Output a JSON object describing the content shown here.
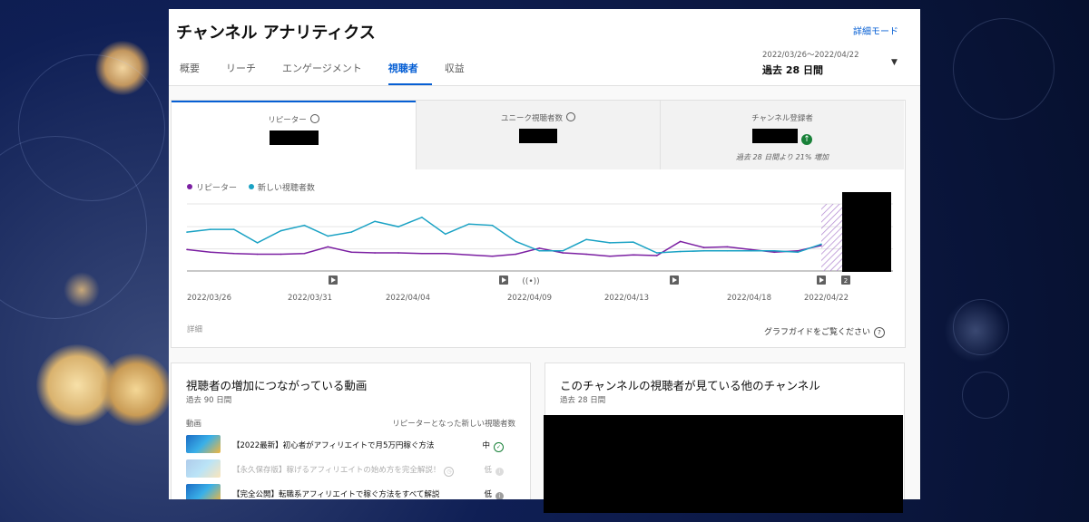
{
  "page": {
    "title": "チャンネル アナリティクス",
    "detail_mode": "詳細モード",
    "tabs": [
      {
        "label": "概要"
      },
      {
        "label": "リーチ"
      },
      {
        "label": "エンゲージメント"
      },
      {
        "label": "視聴者",
        "active": true
      },
      {
        "label": "収益"
      }
    ],
    "date_range": {
      "dates": "2022/03/26〜2022/04/22",
      "period": "過去 28 日間"
    }
  },
  "metrics": [
    {
      "label": "リピーター",
      "value": "",
      "active": true,
      "icon": "clock-icon"
    },
    {
      "label": "ユニーク視聴者数",
      "value": "",
      "icon": "clock-icon"
    },
    {
      "label": "チャンネル登録者",
      "value": "",
      "icon": "up-arrow-icon",
      "note": "過去 28 日間より 21% 増加"
    }
  ],
  "chart_data": {
    "type": "line",
    "series": [
      {
        "name": "リピーター",
        "color": "#7b1fa2",
        "values": [
          32,
          28,
          26,
          25,
          25,
          26,
          36,
          28,
          27,
          27,
          26,
          26,
          24,
          22,
          25,
          34,
          27,
          25,
          22,
          24,
          23,
          44,
          35,
          36,
          32,
          28,
          30,
          38
        ]
      },
      {
        "name": "新しい視聴者数",
        "color": "#1aa2c4",
        "values": [
          58,
          62,
          62,
          42,
          60,
          68,
          52,
          58,
          74,
          66,
          80,
          55,
          70,
          68,
          44,
          30,
          30,
          47,
          42,
          43,
          27,
          29,
          30,
          30,
          30,
          30,
          28,
          40
        ]
      }
    ],
    "x_tick_labels": [
      "2022/03/26",
      "2022/03/31",
      "2022/04/04",
      "2022/04/09",
      "2022/04/13",
      "2022/04/18",
      "2022/04/22"
    ],
    "ylim": [
      0,
      100
    ],
    "legend_position": "top-left",
    "grid": true,
    "markers_count_badge": "2"
  },
  "chart_footer": {
    "details": "詳細",
    "guide": "グラフガイドをご覧ください",
    "guide_icon": "help-icon"
  },
  "growth_videos": {
    "title": "視聴者の増加につながっている動画",
    "subtitle": "過去 90 日間",
    "col_video": "動画",
    "col_metric": "リピーターとなった新しい視聴者数",
    "rows": [
      {
        "title": "【2022最新】初心者がアフィリエイトで月5万円稼ぐ方法",
        "value": "中",
        "faded": false,
        "check_color": "#188038"
      },
      {
        "title": "【永久保存版】稼げるアフィリエイトの始め方を完全解説！",
        "value": "低",
        "faded": true,
        "check_color": "#9e9e9e"
      },
      {
        "title": "【完全公開】転職系アフィリエイトで稼ぐ方法をすべて解説",
        "value": "低",
        "faded": false,
        "check_color": "#9e9e9e"
      }
    ]
  },
  "other_channels": {
    "title": "このチャンネルの視聴者が見ている他のチャンネル",
    "subtitle": "過去 28 日間"
  }
}
